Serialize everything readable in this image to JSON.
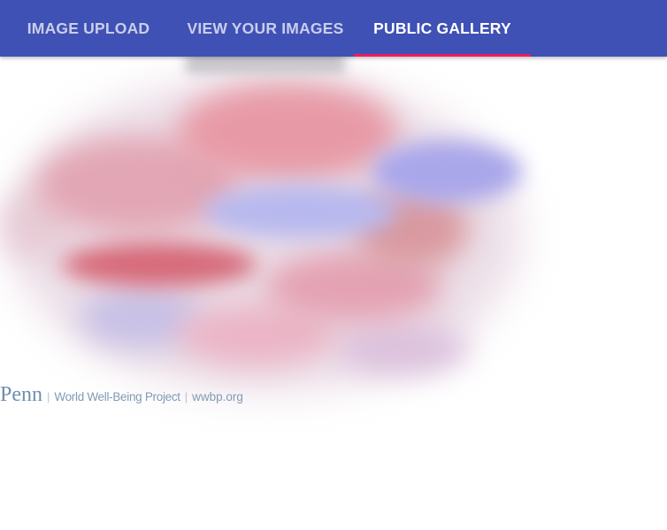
{
  "nav": {
    "tabs": [
      {
        "label": "IMAGE UPLOAD",
        "active": false
      },
      {
        "label": "VIEW YOUR IMAGES",
        "active": false
      },
      {
        "label": "PUBLIC GALLERY",
        "active": true
      }
    ]
  },
  "colors": {
    "appbar": "#3f51b5",
    "indicator": "#e91e63",
    "tab_text_active": "#ffffff",
    "tab_text_inactive": "#c5cae9"
  },
  "gallery": {
    "footer": {
      "brand": "Penn",
      "project": "World Well-Being Project",
      "site": "wwbp.org"
    }
  }
}
